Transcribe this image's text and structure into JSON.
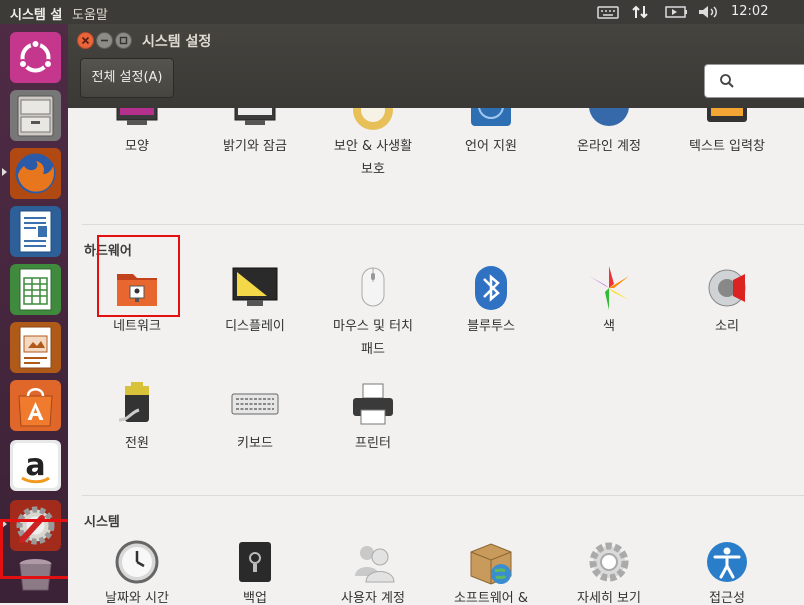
{
  "top_panel": {
    "app_name": "시스템 설",
    "app_menu": "도움말",
    "clock": "12:02"
  },
  "window": {
    "title": "시스템 설정",
    "all_settings_label": "전체 설정(A)",
    "search_placeholder": ""
  },
  "personal": {
    "items": [
      {
        "label": "모양"
      },
      {
        "label": "밝기와 잠금"
      },
      {
        "label": "보안 & 사생활\n보호"
      },
      {
        "label": "언어 지원"
      },
      {
        "label": "온라인 계정"
      },
      {
        "label": "텍스트 입력창"
      }
    ]
  },
  "hardware": {
    "title": "하드웨어",
    "items": [
      {
        "label": "네트워크"
      },
      {
        "label": "디스플레이"
      },
      {
        "label": "마우스 및 터치\n패드"
      },
      {
        "label": "블루투스"
      },
      {
        "label": "색"
      },
      {
        "label": "소리"
      },
      {
        "label": "전원"
      },
      {
        "label": "키보드"
      },
      {
        "label": "프린터"
      }
    ]
  },
  "system": {
    "title": "시스템",
    "items": [
      {
        "label": "날짜와 시간"
      },
      {
        "label": "백업"
      },
      {
        "label": "사용자 계정"
      },
      {
        "label": "소프트웨어 &\n업데이트"
      },
      {
        "label": "자세히 보기"
      },
      {
        "label": "접근성"
      }
    ]
  },
  "colors": {
    "accent": "#e9653b",
    "highlight": "#e21010",
    "launcher": "#4f2b45"
  }
}
